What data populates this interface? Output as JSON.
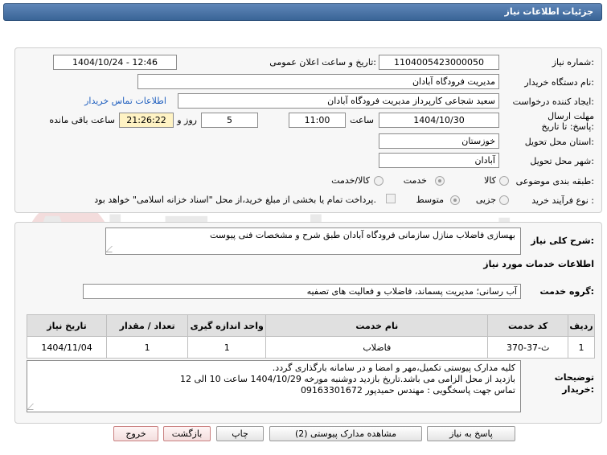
{
  "header": {
    "title": "جزئیات اطلاعات نیاز"
  },
  "fields": {
    "need_number_label": "شماره نیاز:",
    "need_number": "1104005423000050",
    "announce_label": "تاریخ و ساعت اعلان عمومی:",
    "announce_value": "1404/10/24 - 12:46",
    "buyer_org_label": "نام دستگاه خریدار:",
    "buyer_org": "مدیریت فرودگاه آبادان",
    "creator_label": "ایجاد کننده درخواست:",
    "creator": "سعید شجاعی کارپرداز مدیریت فرودگاه آبادان",
    "contact_link": "اطلاعات تماس خریدار",
    "deadline_label": "مهلت ارسال پاسخ: تا تاریخ:",
    "deadline_date": "1404/10/30",
    "time_label": "ساعت",
    "deadline_time": "11:00",
    "days_value": "5",
    "days_label": "روز و",
    "remaining_time": "21:26:22",
    "remaining_label": "ساعت باقی مانده",
    "province_label": "استان محل تحویل:",
    "province": "خوزستان",
    "city_label": "شهر محل تحویل:",
    "city": "آبادان",
    "category_label": "طبقه بندی موضوعی:",
    "category_options": [
      "کالا",
      "خدمت",
      "کالا/خدمت"
    ],
    "purchase_type_label": "نوع فرآیند خرید :",
    "purchase_options": [
      "جزیی",
      "متوسط"
    ],
    "payment_note": "پرداخت تمام یا بخشی از مبلغ خرید،از محل \"اسناد خزانه اسلامی\" خواهد بود."
  },
  "need": {
    "summary_label": "شرح کلی نیاز:",
    "summary": "بهسازی فاضلاب منازل سازمانی فرودگاه آبادان طبق شرح و مشخصات فنی پیوست",
    "services_heading": "اطلاعات خدمات مورد نیاز",
    "service_group_label": "گروه خدمت:",
    "service_group": "آب رسانی؛ مدیریت پسماند، فاضلاب و فعالیت های تصفیه"
  },
  "table": {
    "headers": [
      "ردیف",
      "کد خدمت",
      "نام خدمت",
      "واحد اندازه گیری",
      "تعداد / مقدار",
      "تاریخ نیاز"
    ],
    "rows": [
      [
        "1",
        "ث-37-370",
        "فاضلاب",
        "1",
        "1",
        "1404/11/04"
      ]
    ]
  },
  "buyer_notes": {
    "label": "توضیحات خریدار:",
    "lines": [
      "کلیه مدارک پیوستی تکمیل،مهر و امضا و در سامانه بارگذاری گردد.",
      "بازدید از محل الزامی می باشد.تاریخ بازدید دوشنبه مورخه 1404/10/29 ساعت 10 الی 12",
      "تماس جهت پاسخگویی : مهندس حمیدپور 09163301672"
    ]
  },
  "buttons": {
    "reply": "پاسخ به نیاز",
    "attachments": "مشاهده مدارک پیوستی (2)",
    "print": "چاپ",
    "back": "بازگشت",
    "exit": "خروج"
  },
  "watermark": {
    "text": "AriaTender.net"
  },
  "colors": {
    "header_bg": "#3f6a9c",
    "link": "#1f5fbf",
    "panel_bg": "#f7f7f7",
    "remaining_bg": "#fff3c4"
  }
}
